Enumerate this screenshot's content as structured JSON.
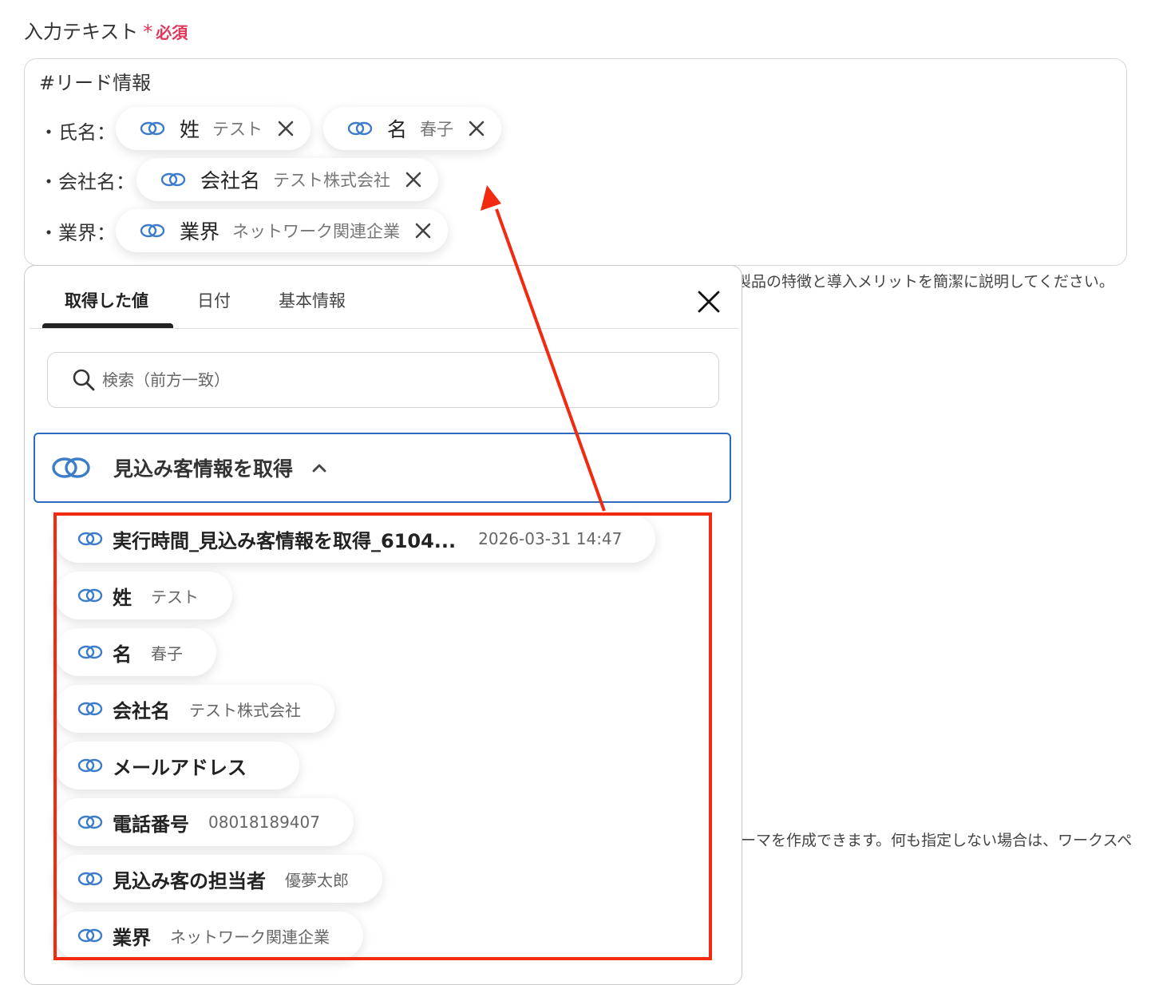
{
  "field": {
    "label": "入力テキスト",
    "required_mark": "*",
    "required_text": "必須"
  },
  "editor": {
    "header": "#リード情報",
    "rows": [
      {
        "label": "・氏名：",
        "pills": [
          {
            "name": "姓",
            "value": "テスト"
          },
          {
            "name": "名",
            "value": "春子"
          }
        ]
      },
      {
        "label": "・会社名：",
        "pills": [
          {
            "name": "会社名",
            "value": "テスト株式会社"
          }
        ]
      },
      {
        "label": "・業界：",
        "pills": [
          {
            "name": "業界",
            "value": "ネットワーク関連企業"
          }
        ]
      }
    ]
  },
  "hints": {
    "hint1": "製品の特徴と導入メリットを簡潔に説明してください。",
    "hint2": "ーマを作成できます。何も指定しない場合は、ワークスペ"
  },
  "panel": {
    "tabs": [
      "取得した値",
      "日付",
      "基本情報"
    ],
    "active_tab": "取得した値",
    "search_placeholder": "検索（前方一致）",
    "section_title": "見込み客情報を取得",
    "outputs": [
      {
        "name": "実行時間_見込み客情報を取得_6104...",
        "value": "2026-03-31 14:47"
      },
      {
        "name": "姓",
        "value": "テスト"
      },
      {
        "name": "名",
        "value": "春子"
      },
      {
        "name": "会社名",
        "value": "テスト株式会社"
      },
      {
        "name": "メールアドレス",
        "value": ""
      },
      {
        "name": "電話番号",
        "value": "08018189407"
      },
      {
        "name": "見込み客の担当者",
        "value": "優夢太郎"
      },
      {
        "name": "業界",
        "value": "ネットワーク関連企業"
      }
    ]
  },
  "colors": {
    "required": "#e0365a",
    "accent_blue": "#2d6bbf",
    "annotation_red": "#f22a10"
  },
  "icons": {
    "link": "link-chain-icon",
    "close": "close-icon",
    "search": "search-icon",
    "chevron": "chevron-up-icon"
  }
}
